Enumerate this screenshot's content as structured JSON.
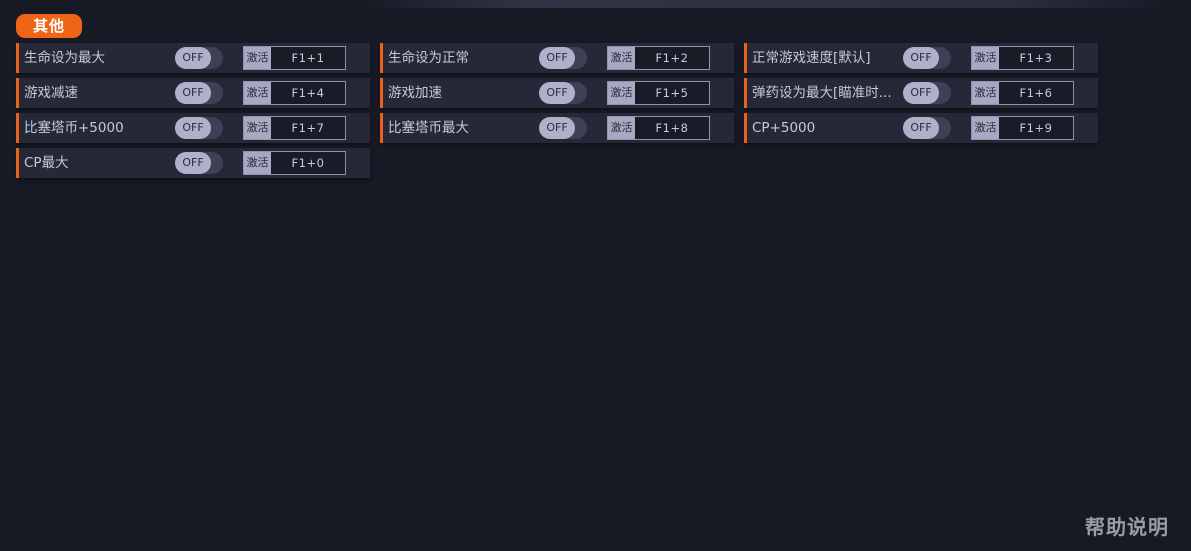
{
  "section": {
    "title": "其他"
  },
  "rows": [
    [
      {
        "label": "生命设为最大",
        "toggle": "OFF",
        "action": "激活",
        "hotkey": "F1+1"
      },
      {
        "label": "生命设为正常",
        "toggle": "OFF",
        "action": "激活",
        "hotkey": "F1+2"
      },
      {
        "label": "正常游戏速度[默认]",
        "toggle": "OFF",
        "action": "激活",
        "hotkey": "F1+3"
      }
    ],
    [
      {
        "label": "游戏减速",
        "toggle": "OFF",
        "action": "激活",
        "hotkey": "F1+4"
      },
      {
        "label": "游戏加速",
        "toggle": "OFF",
        "action": "激活",
        "hotkey": "F1+5"
      },
      {
        "label": "弹药设为最大[瞄准时...",
        "toggle": "OFF",
        "action": "激活",
        "hotkey": "F1+6"
      }
    ],
    [
      {
        "label": "比塞塔币+5000",
        "toggle": "OFF",
        "action": "激活",
        "hotkey": "F1+7"
      },
      {
        "label": "比塞塔币最大",
        "toggle": "OFF",
        "action": "激活",
        "hotkey": "F1+8"
      },
      {
        "label": "CP+5000",
        "toggle": "OFF",
        "action": "激活",
        "hotkey": "F1+9"
      }
    ],
    [
      {
        "label": "CP最大",
        "toggle": "OFF",
        "action": "激活",
        "hotkey": "F1+0"
      }
    ]
  ],
  "footer": {
    "help_label": "帮助说明"
  },
  "colors": {
    "background": "#171925",
    "accent": "#f06418",
    "item_background": "#262838",
    "toggle_knob": "#aeb1c9"
  }
}
